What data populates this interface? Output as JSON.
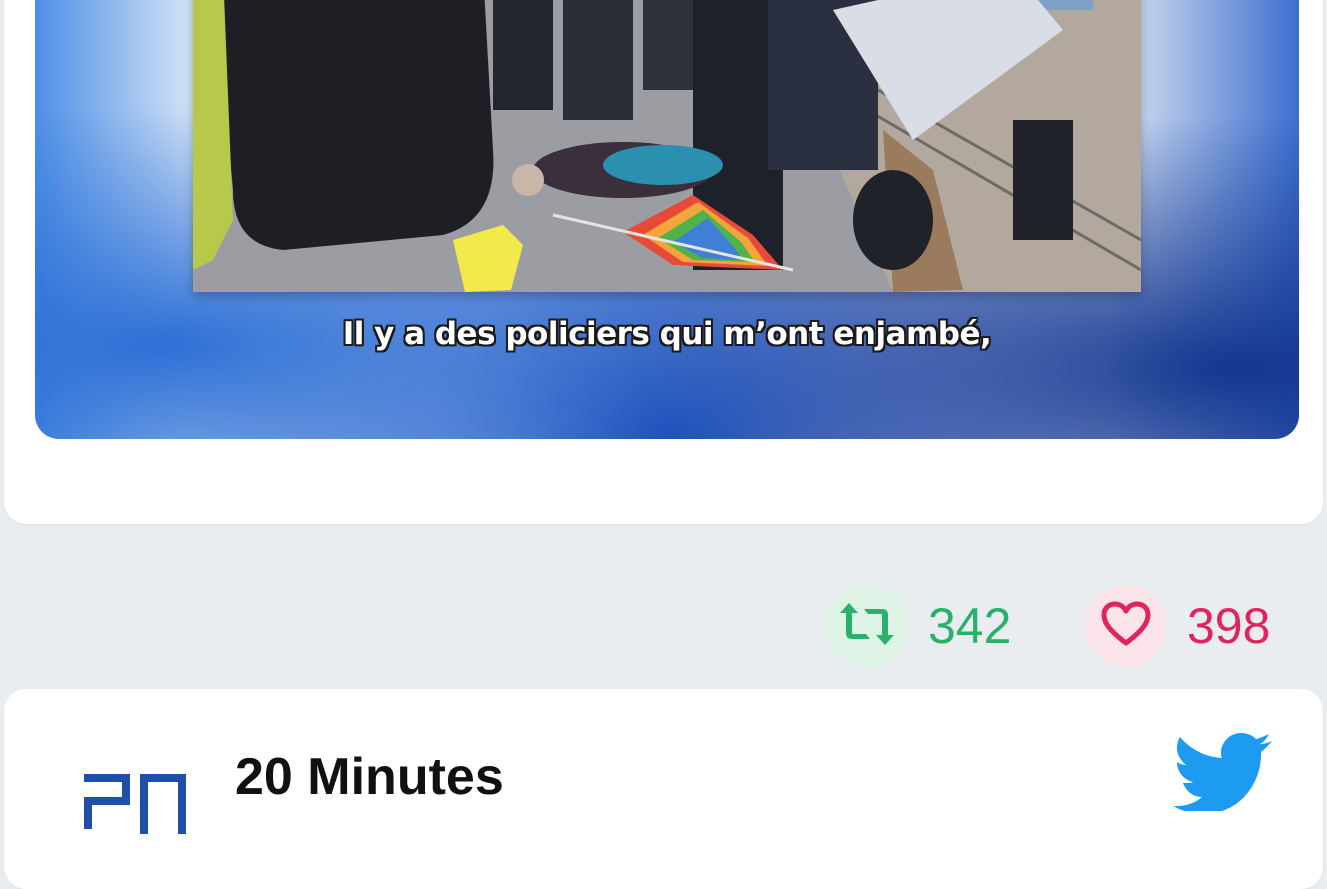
{
  "tweet": {
    "media": {
      "caption": "Il y a des policiers qui m’ont enjambé,"
    },
    "actions": {
      "retweet_count": "342",
      "like_count": "398",
      "retweet_icon": "retweet-icon",
      "like_icon": "heart-icon"
    }
  },
  "next_tweet": {
    "account_name": "20 Minutes",
    "avatar": "20-minutes-logo",
    "platform_icon": "twitter-bird-icon"
  },
  "colors": {
    "retweet": "#29b16b",
    "like": "#e0245e",
    "twitter_blue": "#1d9bf0",
    "background": "#e9edf0"
  }
}
